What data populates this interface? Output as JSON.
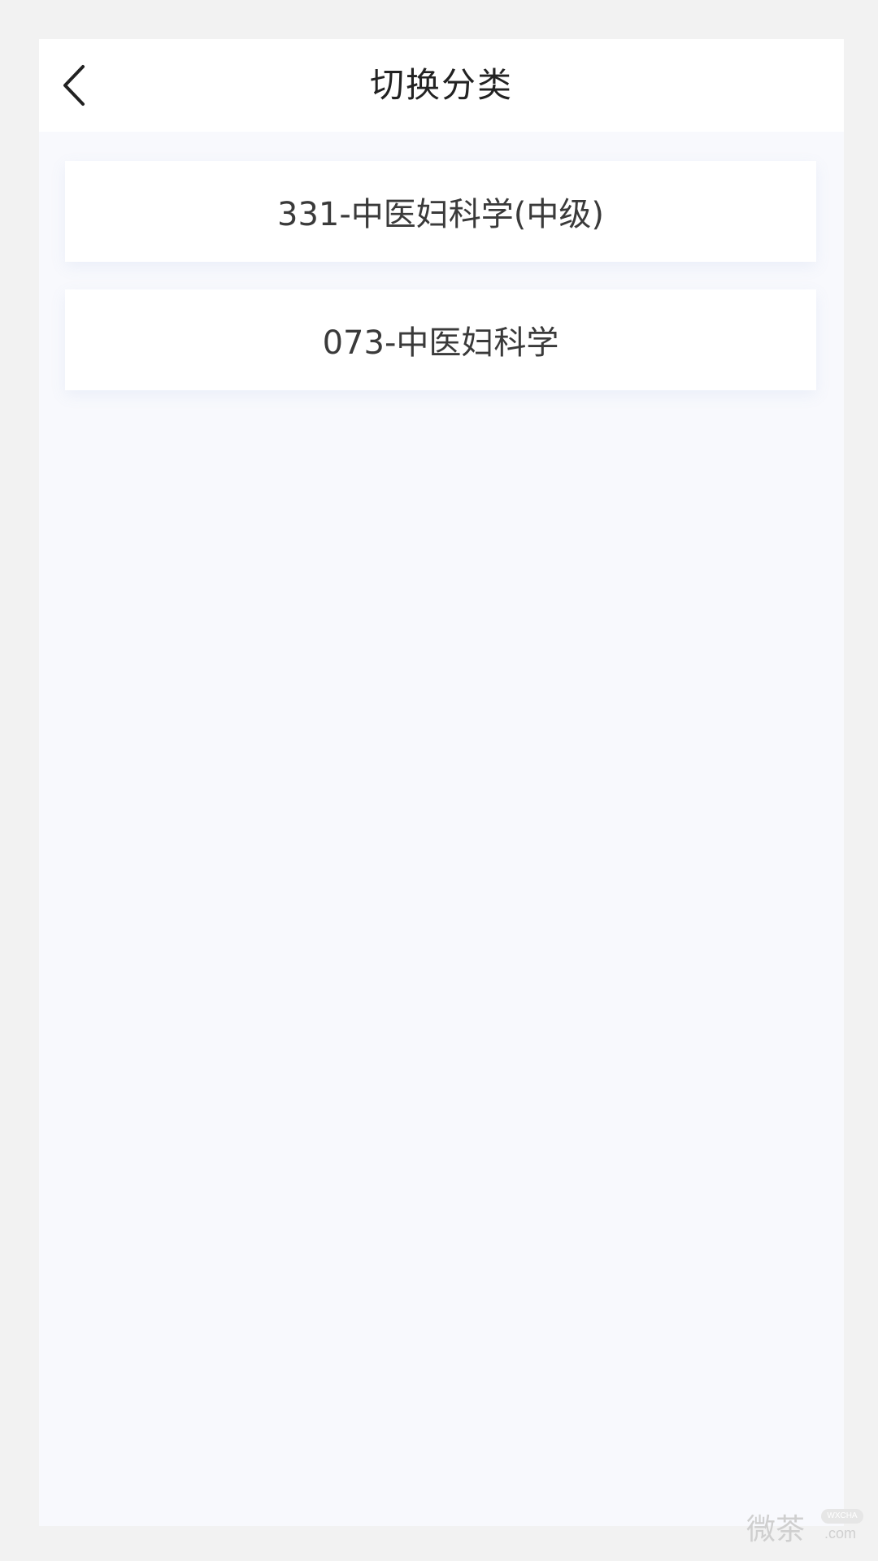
{
  "header": {
    "title": "切换分类",
    "back_icon": "chevron-left-icon"
  },
  "categories": [
    {
      "label": "331-中医妇科学(中级)"
    },
    {
      "label": "073-中医妇科学"
    }
  ],
  "watermark": {
    "text": "微茶",
    "badge": "WXCHA",
    "domain": ".com"
  },
  "colors": {
    "page_bg": "#f2f2f2",
    "content_bg": "#f8f9fd",
    "card_bg": "#ffffff",
    "title_text": "#222222",
    "item_text": "#3a3a3a"
  }
}
